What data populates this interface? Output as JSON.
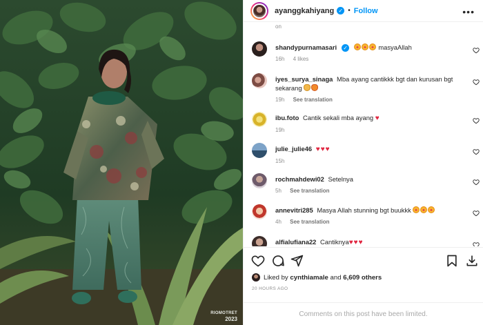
{
  "post": {
    "username": "ayanggkahiyang",
    "follow_label": "Follow",
    "separator": "•",
    "more_label": "•••"
  },
  "photo": {
    "watermark_line1": "RIOMOTRET",
    "watermark_line2": "2023"
  },
  "comments": {
    "top_fragment": "on",
    "items": [
      {
        "user": "shandypurnamasari",
        "verified": true,
        "text": "masyaAllah",
        "emoji_before": [
          "star-struck",
          "star-struck",
          "star-struck"
        ],
        "time": "16h",
        "likes": "4 likes",
        "translation": ""
      },
      {
        "user": "iyes_surya_sinaga",
        "verified": false,
        "text": "Mba ayang cantikkk bgt dan kurusan bgt sekarang",
        "emoji_after": [
          "clap",
          "fire"
        ],
        "time": "19h",
        "likes": "",
        "translation": "See translation"
      },
      {
        "user": "ibu.foto",
        "verified": false,
        "text": "Cantik sekali mba ayang",
        "emoji_after": [
          "red-heart"
        ],
        "time": "19h",
        "likes": "",
        "translation": ""
      },
      {
        "user": "julie_julie46",
        "verified": false,
        "text": "",
        "emoji_after": [
          "red-heart",
          "red-heart",
          "red-heart"
        ],
        "time": "15h",
        "likes": "",
        "translation": ""
      },
      {
        "user": "rochmahdewi02",
        "verified": false,
        "text": "Setelnya",
        "time": "5h",
        "likes": "",
        "translation": "See translation"
      },
      {
        "user": "annevitri285",
        "verified": false,
        "text": "Masya Allah stunning bgt buukkk",
        "emoji_after": [
          "star-struck",
          "star-struck",
          "star-struck"
        ],
        "time": "4h",
        "likes": "",
        "translation": "See translation"
      },
      {
        "user": "alfialufiana22",
        "verified": false,
        "text": "Cantiknya",
        "emoji_after": [
          "red-heart",
          "red-heart",
          "red-heart"
        ],
        "time": "",
        "likes": "",
        "translation": ""
      }
    ]
  },
  "actions": {
    "like_icon": "heart-icon",
    "comment_icon": "comment-icon",
    "share_icon": "share-icon",
    "save_icon": "bookmark-icon",
    "download_icon": "download-icon"
  },
  "likes": {
    "prefix": "Liked by",
    "user": "cynthiamale",
    "middle": "and",
    "others": "6,609 others"
  },
  "timestamp": "20 HOURS AGO",
  "comments_limited": "Comments on this post have been limited.",
  "colors": {
    "accent": "#0095f6",
    "heart": "#e0253f",
    "muted": "#8e8e8e"
  }
}
